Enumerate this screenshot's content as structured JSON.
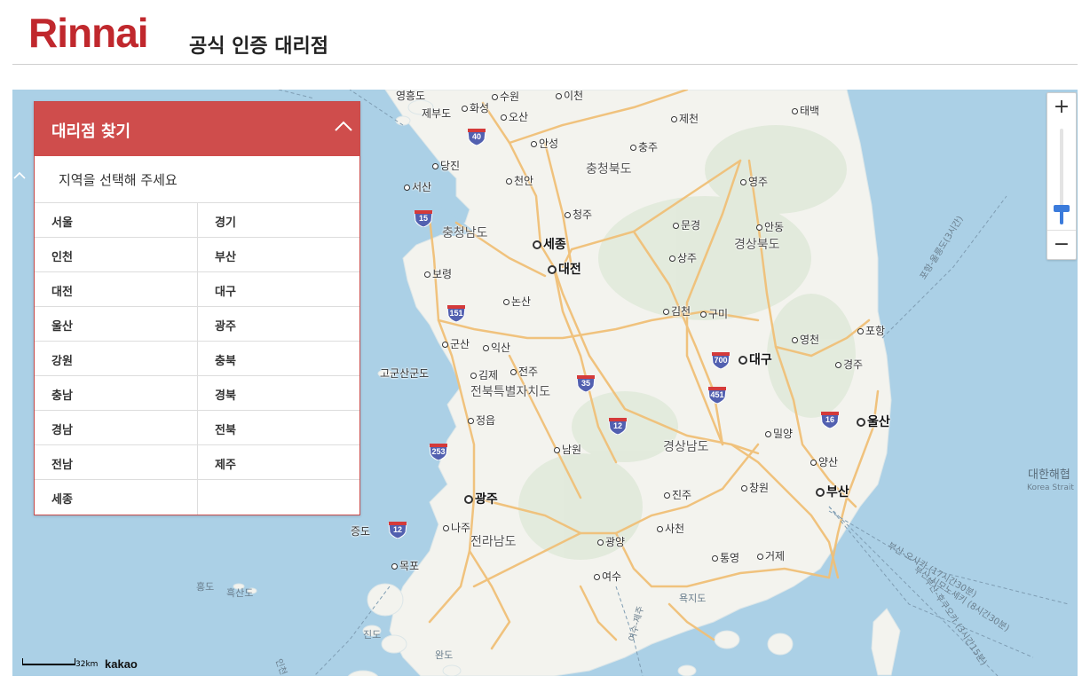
{
  "header": {
    "logo_text": "Rinnai",
    "logo_color": "#c0282d",
    "subtitle": "공식 인증 대리점"
  },
  "panel": {
    "title": "대리점 찾기",
    "toggle_icon": "chevron-up-icon",
    "prompt": "지역을 선택해 주세요",
    "regions": [
      "서울",
      "경기",
      "인천",
      "부산",
      "대전",
      "대구",
      "울산",
      "광주",
      "강원",
      "충북",
      "충남",
      "경북",
      "경남",
      "전북",
      "전남",
      "제주",
      "세종"
    ],
    "header_color": "#cf4d4c"
  },
  "map": {
    "places": {
      "yeongheungdo": "영흥도",
      "jebudo": "제부도",
      "suwon": "수원",
      "icheon": "이천",
      "hwaseong": "화성",
      "osan": "오산",
      "jecheon": "제천",
      "taebaek": "태백",
      "anseong": "안성",
      "chungju": "충주",
      "dangjin": "당진",
      "chungbuk": "충청북도",
      "cheonan": "천안",
      "seosan": "서산",
      "yeongju": "영주",
      "cheongju": "청주",
      "mungyeong": "문경",
      "andong": "안동",
      "chungnam": "충청남도",
      "sejong": "세종",
      "gyeongbuk": "경상북도",
      "sangju": "상주",
      "boryeong": "보령",
      "daejeon": "대전",
      "nonsan": "논산",
      "gimcheon": "김천",
      "gumi": "구미",
      "pohang": "포항",
      "gunsan": "군산",
      "iksan": "익산",
      "yeongcheon": "영천",
      "daegu": "대구",
      "gogunsan": "고군산군도",
      "gimje": "김제",
      "jeonju": "전주",
      "gyeongju": "경주",
      "jeonbuk": "전북특별자치도",
      "jeongeup": "정읍",
      "ulsan": "울산",
      "miryang": "밀양",
      "gyeongnam": "경상남도",
      "namwon": "남원",
      "yangsan": "양산",
      "gwangju": "광주",
      "jinju": "진주",
      "changwon": "창원",
      "busan": "부산",
      "jeungdo": "증도",
      "naju": "나주",
      "sacheon": "사천",
      "jeonnam": "전라남도",
      "gwangyang": "광양",
      "tongyeong": "통영",
      "geoje": "거제",
      "mokpo": "목포",
      "yeosu": "여수",
      "hongdo": "홍도",
      "heuksando": "흑산도",
      "yokjido": "욕지도",
      "jindo": "진도",
      "wando": "완도",
      "korea_strait_kr": "대한해협",
      "korea_strait_en": "Korea Strait",
      "route_busan_shimonoseki": "부산-시모노세키 (8시간30분)",
      "route_busan_osaka": "부산-오사카 (17시간30분)",
      "route_busan_fukuoka": "부산-후쿠오카 (3시간15분)",
      "route_pohang_ulleung": "포항-울릉도(3시간)",
      "route_yeosu_jeju": "여수-제주",
      "route_incheon": "인천"
    },
    "highways": [
      "40",
      "15",
      "151",
      "35",
      "700",
      "451",
      "12",
      "16",
      "253",
      "12"
    ],
    "sea_color": "#abd0e6",
    "land_color": "#f3f3ee",
    "road_color": "#f0c078",
    "highway_shield_color": "#5260b0"
  },
  "zoom": {
    "plus_label": "+",
    "minus_label": "−",
    "level": 0.83,
    "accent": "#3b7bdb"
  },
  "attribution": {
    "scale_label": "32km",
    "provider": "kakao"
  }
}
